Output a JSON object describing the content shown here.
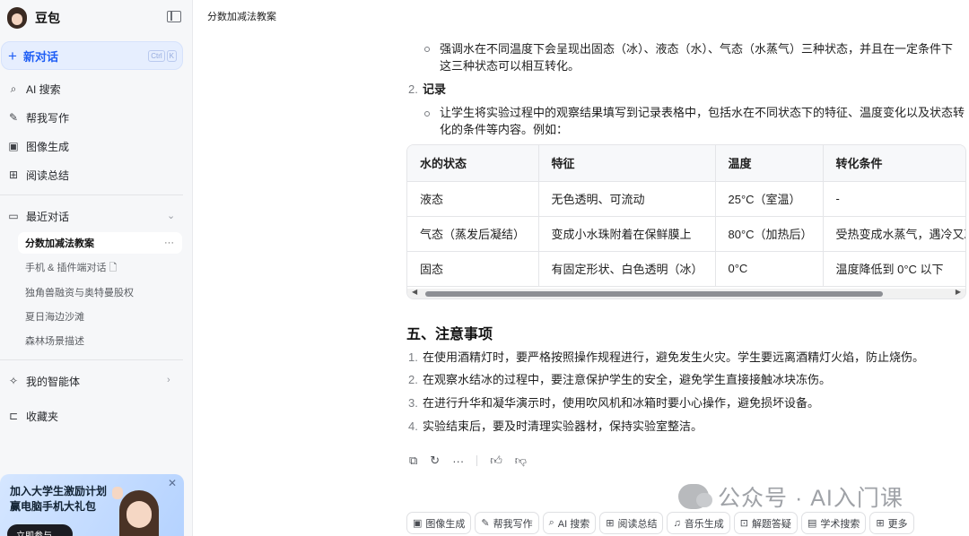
{
  "sidebar": {
    "brand": "豆包",
    "new_chat": {
      "label": "新对话",
      "shortcut": [
        "Ctrl",
        "K"
      ]
    },
    "nav": [
      {
        "icon": "ai-search-icon",
        "label": "AI 搜索"
      },
      {
        "icon": "writing-icon",
        "label": "帮我写作"
      },
      {
        "icon": "image-icon",
        "label": "图像生成"
      },
      {
        "icon": "reading-icon",
        "label": "阅读总结"
      }
    ],
    "recent_header": "最近对话",
    "recent": [
      {
        "label": "分数加减法教案",
        "active": true
      },
      {
        "label": "手机 & 插件端对话 🗋"
      },
      {
        "label": "独角兽融资与奥特曼股权"
      },
      {
        "label": "夏日海边沙滩"
      },
      {
        "label": "森林场景描述"
      }
    ],
    "agents": "我的智能体",
    "favorites": "收藏夹",
    "promo": {
      "title": "加入大学生激励计划 赢电脑手机大礼包",
      "button": "立即参与 →"
    }
  },
  "main": {
    "title": "分数加减法教案",
    "bullet1": "强调水在不同温度下会呈现出固态（冰）、液态（水）、气态（水蒸气）三种状态，并且在一定条件下",
    "bullet1_cont": "这三种状态可以相互转化。",
    "item2_num": "2.",
    "item2_title": "记录",
    "bullet2": "让学生将实验过程中的观察结果填写到记录表格中，包括水在不同状态下的特征、温度变化以及状态转",
    "bullet2_cont": "化的条件等内容。例如：",
    "table": {
      "headers": [
        "水的状态",
        "特征",
        "温度",
        "转化条件"
      ],
      "rows": [
        [
          "液态",
          "无色透明、可流动",
          "25°C（室温）",
          "-"
        ],
        [
          "气态（蒸发后凝结）",
          "变成小水珠附着在保鲜膜上",
          "80°C（加热后）",
          "受热变成水蒸气，遇冷又凝"
        ],
        [
          "固态",
          "有固定形状、白色透明（冰）",
          "0°C",
          "温度降低到 0°C 以下"
        ]
      ]
    },
    "section5": "五、注意事项",
    "notes": [
      {
        "n": "1.",
        "text": "在使用酒精灯时，要严格按照操作规程进行，避免发生火灾。学生要远离酒精灯火焰，防止烧伤。"
      },
      {
        "n": "2.",
        "text": "在观察水结冰的过程中，要注意保护学生的安全，避免学生直接接触冰块冻伤。"
      },
      {
        "n": "3.",
        "text": "在进行升华和凝华演示时，使用吹风机和冰箱时要小心操作，避免损坏设备。"
      },
      {
        "n": "4.",
        "text": "实验结束后，要及时清理实验器材，保持实验室整洁。"
      }
    ],
    "watermark": "公众号 · AI入门课",
    "chips": [
      {
        "icon": "image-icon",
        "label": "图像生成"
      },
      {
        "icon": "writing-icon",
        "label": "帮我写作"
      },
      {
        "icon": "ai-search-icon",
        "label": "AI 搜索"
      },
      {
        "icon": "reading-icon",
        "label": "阅读总结"
      },
      {
        "icon": "music-icon",
        "label": "音乐生成"
      },
      {
        "icon": "solve-icon",
        "label": "解题答疑"
      },
      {
        "icon": "academic-search-icon",
        "label": "学术搜索"
      },
      {
        "icon": "more-icon",
        "label": "更多"
      }
    ]
  }
}
